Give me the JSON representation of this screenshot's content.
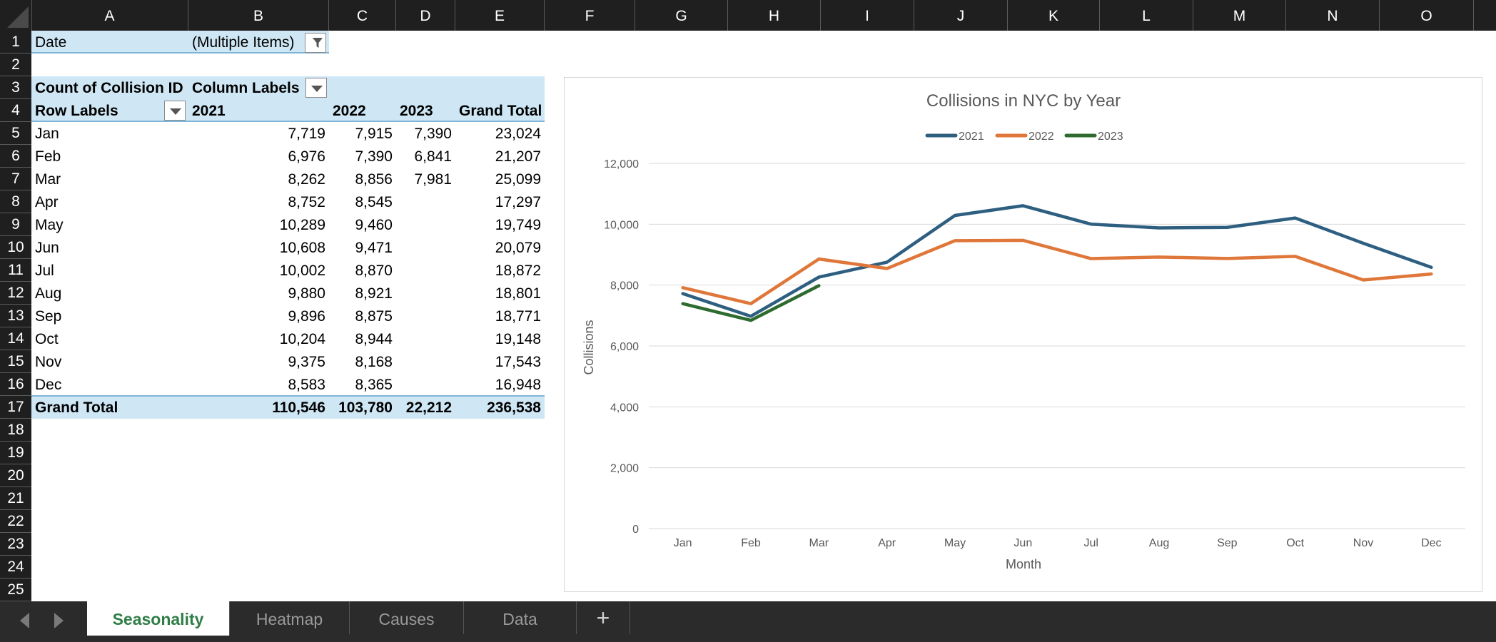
{
  "columns": [
    "A",
    "B",
    "C",
    "D",
    "E",
    "F",
    "G",
    "H",
    "I",
    "J",
    "K",
    "L",
    "M",
    "N",
    "O"
  ],
  "rows": [
    "1",
    "2",
    "3",
    "4",
    "5",
    "6",
    "7",
    "8",
    "9",
    "10",
    "11",
    "12",
    "13",
    "14",
    "15",
    "16",
    "17",
    "18",
    "19",
    "20",
    "21",
    "22",
    "23",
    "24",
    "25"
  ],
  "pivot": {
    "filter_label": "Date",
    "filter_value": "(Multiple Items)",
    "measure": "Count of Collision ID",
    "column_labels": "Column Labels",
    "row_labels": "Row Labels",
    "year_headers": [
      "2021",
      "2022",
      "2023",
      "Grand Total"
    ],
    "months": [
      {
        "m": "Jan",
        "v2021": "7,719",
        "v2022": "7,915",
        "v2023": "7,390",
        "total": "23,024"
      },
      {
        "m": "Feb",
        "v2021": "6,976",
        "v2022": "7,390",
        "v2023": "6,841",
        "total": "21,207"
      },
      {
        "m": "Mar",
        "v2021": "8,262",
        "v2022": "8,856",
        "v2023": "7,981",
        "total": "25,099"
      },
      {
        "m": "Apr",
        "v2021": "8,752",
        "v2022": "8,545",
        "v2023": "",
        "total": "17,297"
      },
      {
        "m": "May",
        "v2021": "10,289",
        "v2022": "9,460",
        "v2023": "",
        "total": "19,749"
      },
      {
        "m": "Jun",
        "v2021": "10,608",
        "v2022": "9,471",
        "v2023": "",
        "total": "20,079"
      },
      {
        "m": "Jul",
        "v2021": "10,002",
        "v2022": "8,870",
        "v2023": "",
        "total": "18,872"
      },
      {
        "m": "Aug",
        "v2021": "9,880",
        "v2022": "8,921",
        "v2023": "",
        "total": "18,801"
      },
      {
        "m": "Sep",
        "v2021": "9,896",
        "v2022": "8,875",
        "v2023": "",
        "total": "18,771"
      },
      {
        "m": "Oct",
        "v2021": "10,204",
        "v2022": "8,944",
        "v2023": "",
        "total": "19,148"
      },
      {
        "m": "Nov",
        "v2021": "9,375",
        "v2022": "8,168",
        "v2023": "",
        "total": "17,543"
      },
      {
        "m": "Dec",
        "v2021": "8,583",
        "v2022": "8,365",
        "v2023": "",
        "total": "16,948"
      }
    ],
    "grand_total": {
      "label": "Grand Total",
      "v2021": "110,546",
      "v2022": "103,780",
      "v2023": "22,212",
      "total": "236,538"
    }
  },
  "chart_data": {
    "type": "line",
    "title": "Collisions in NYC by Year",
    "xlabel": "Month",
    "ylabel": "Collisions",
    "categories": [
      "Jan",
      "Feb",
      "Mar",
      "Apr",
      "May",
      "Jun",
      "Jul",
      "Aug",
      "Sep",
      "Oct",
      "Nov",
      "Dec"
    ],
    "ylim": [
      0,
      12000
    ],
    "yticks": [
      0,
      2000,
      4000,
      6000,
      8000,
      10000,
      12000
    ],
    "ytick_labels": [
      "0",
      "2,000",
      "4,000",
      "6,000",
      "8,000",
      "10,000",
      "12,000"
    ],
    "grid": true,
    "legend": "top",
    "series": [
      {
        "name": "2021",
        "color": "#2e5f80",
        "values": [
          7719,
          6976,
          8262,
          8752,
          10289,
          10608,
          10002,
          9880,
          9896,
          10204,
          9375,
          8583
        ]
      },
      {
        "name": "2022",
        "color": "#e0773a",
        "values": [
          7915,
          7390,
          8856,
          8545,
          9460,
          9471,
          8870,
          8921,
          8875,
          8944,
          8168,
          8365
        ]
      },
      {
        "name": "2023",
        "color": "#2f6b2f",
        "values": [
          7390,
          6841,
          7981
        ]
      }
    ]
  },
  "tabs": [
    {
      "label": "Seasonality",
      "active": true
    },
    {
      "label": "Heatmap",
      "active": false
    },
    {
      "label": "Causes",
      "active": false
    },
    {
      "label": "Data",
      "active": false
    }
  ],
  "colors": {
    "header_bg": "#1f1f1f",
    "pivot_fill": "#cfe7f5",
    "active_tab_text": "#2e7d46"
  }
}
